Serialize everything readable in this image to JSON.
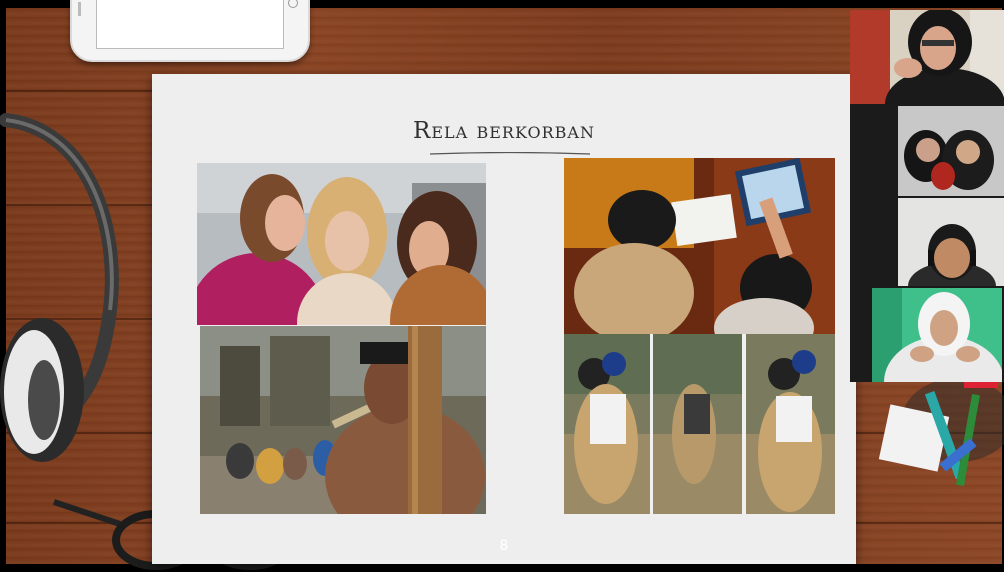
{
  "slide": {
    "title": "Rela berkorban",
    "page_number": "8"
  },
  "photos": [
    {
      "name": "photo-women-comforting"
    },
    {
      "name": "photo-children-computer"
    },
    {
      "name": "photo-man-carrying-pole"
    },
    {
      "name": "photo-students-piggyback"
    }
  ],
  "video_participants": [
    {
      "name": "participant-tile-1"
    },
    {
      "name": "participant-tile-2"
    },
    {
      "name": "participant-tile-3"
    },
    {
      "name": "participant-tile-4"
    }
  ],
  "colors": {
    "desk": "#7d3c1e",
    "slide_bg": "#eeeeee",
    "title_text": "#303030"
  }
}
